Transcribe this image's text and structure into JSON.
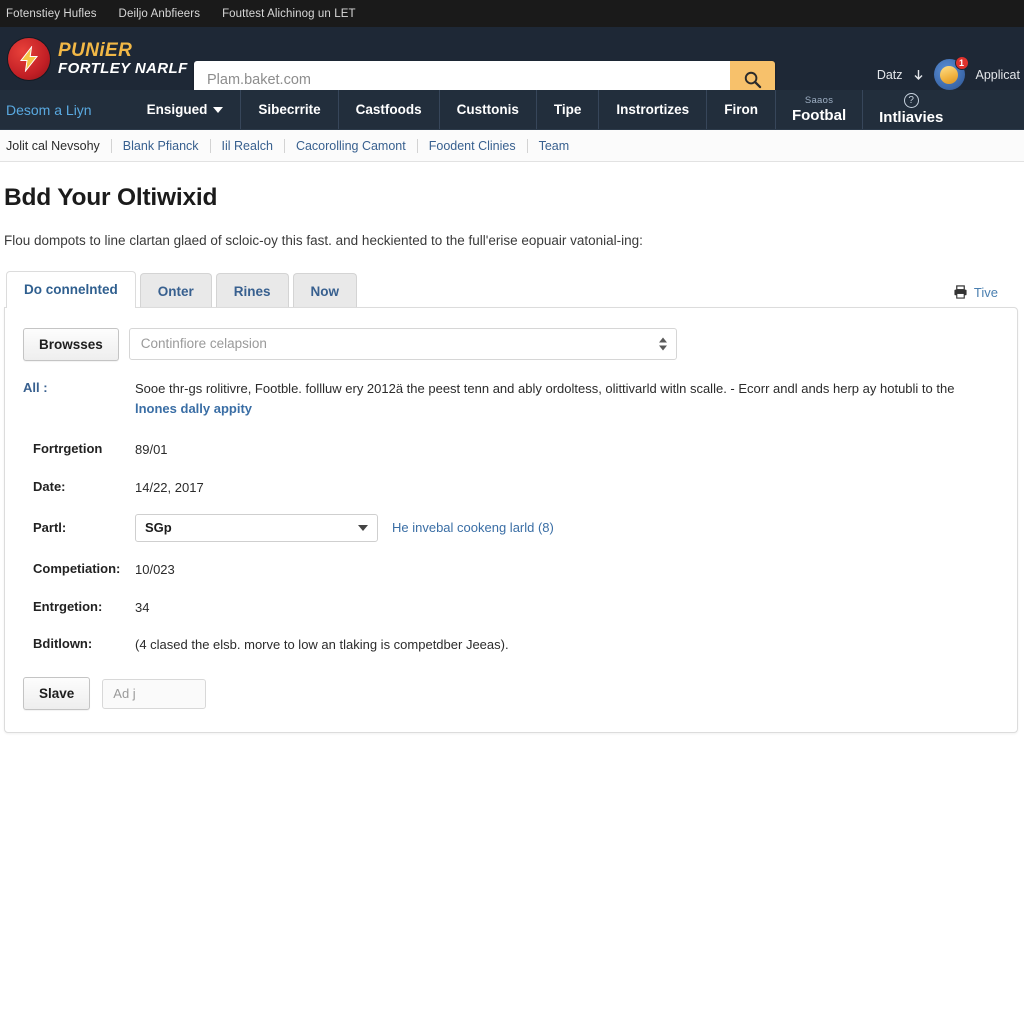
{
  "utility_bar": {
    "links": [
      "Fotenstiey Hufles",
      "Deiljo Anbfieers",
      "Fouttest Alichinog un LET"
    ]
  },
  "masthead": {
    "logo": {
      "line1": "PUNiER",
      "line2": "FORTLEY NARLF",
      "icon": "lightning-bolt-icon"
    },
    "search": {
      "placeholder": "Plam.baket.com",
      "value": "",
      "button_icon": "search-icon"
    },
    "right": {
      "data_label": "Datz",
      "avatar_badge": "1",
      "avatar_icon": "user-avatar-icon",
      "application_label": "Applicat"
    }
  },
  "mainnav": {
    "brand_link": "Desom a Liyn",
    "items": [
      {
        "label": "Ensigued",
        "has_caret": true
      },
      {
        "label": "Sibecrrite",
        "has_caret": false
      },
      {
        "label": "Castfoods",
        "has_caret": false
      },
      {
        "label": "Custtonis",
        "has_caret": false
      },
      {
        "label": "Tipe",
        "has_caret": false
      },
      {
        "label": "Instrortizes",
        "has_caret": false
      },
      {
        "label": "Firon",
        "has_caret": false
      }
    ],
    "stacked": [
      {
        "sub": "Saaos",
        "main": "Footbal"
      }
    ],
    "help": {
      "icon": "question-mark-icon",
      "label": "Intliavies"
    }
  },
  "breadcrumb": {
    "items": [
      "Jolit cal Nevsohy",
      "Blank Pfianck",
      "Iil Realch",
      "Cacorolling Camont",
      "Foodent Clinies",
      "Team"
    ]
  },
  "page": {
    "title": "Bdd Your Oltiwixid",
    "description": "Flou dompots to line clartan glaed of scloic-oy this fast. and heckiented to the full'erise eopuair vatonial-ing:"
  },
  "tabs": {
    "items": [
      "Do connelnted",
      "Onter",
      "Rines",
      "Now"
    ],
    "active_index": 0,
    "right_action": {
      "icon": "print-icon",
      "label": "Tive"
    }
  },
  "form": {
    "browse_button": "Browsses",
    "file_input_placeholder": "Continfiore celapsion",
    "all_label": "All :",
    "all_value": "Sooe thr-gs rolitivre, Footble. follluw ery 2012ä the peest tenn and ably ordoltess, olittivarld witln scalle. - Ecorr andl ands herp ay hotubli to the",
    "all_value_link": "lnones dally appity",
    "rows": [
      {
        "label": "Fortrgetion",
        "value": "89/01"
      },
      {
        "label": "Date:",
        "value": "14/22, 2017"
      }
    ],
    "party": {
      "label": "Partl:",
      "selected": "SGp",
      "link_text": "He invebal cookeng larld (8)"
    },
    "rows2": [
      {
        "label": "Competiation:",
        "value": "10/023"
      },
      {
        "label": "Entrgetion:",
        "value": "34"
      },
      {
        "label": "Bditlown:",
        "value": "(4 clased the elsb. morve to low an tlaking is competdber Jeeas)."
      }
    ],
    "save_button": "Slave",
    "add_field_placeholder": "Ad j"
  },
  "colors": {
    "masthead_bg": "#1e2836",
    "nav_bg": "#222e3c",
    "utility_bg": "#1a1a1a",
    "accent_yellow": "#f7c16b",
    "logo_red": "#c21f25",
    "link_blue": "#38608f"
  }
}
